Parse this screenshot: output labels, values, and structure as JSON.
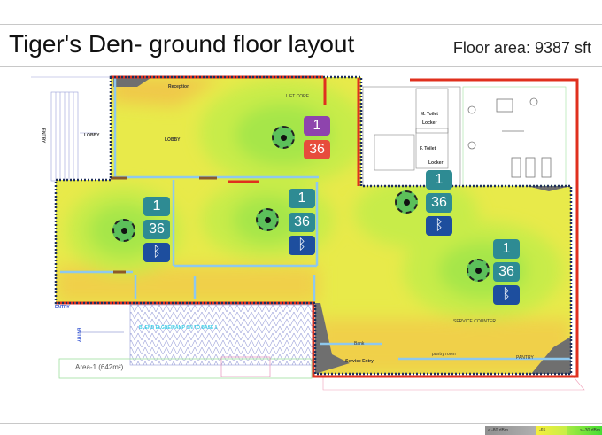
{
  "header": {
    "title": "Tiger's Den- ground floor layout",
    "floor_area": "Floor area: 9387 sft"
  },
  "rooms": {
    "lobby_outer": "LOBBY",
    "lobby_inner": "LOBBY",
    "reception": "Reception",
    "lift_core": "LIFT CORE",
    "m_toilet": "M. Toilet",
    "locker_1": "Locker",
    "f_toilet": "F. Toilet",
    "locker_2": "Locker",
    "service_counter": "SERVICE COUNTER",
    "pantry_room": "pantry room",
    "pantry": "PANTRY",
    "service_entry": "Service Entry",
    "bank": "Bank",
    "entry_top": "ENTRY",
    "entry_bottom": "ENTRY",
    "entry_corner": "ENTRY",
    "ramp": "BLEND ELGNE/RAMP ON TO BASE 1",
    "area1": "Area-1 (642m²)"
  },
  "access_points": [
    {
      "name": "ap-reception",
      "count": "1",
      "signal": "36",
      "count_color": "#8e44ad",
      "signal_color": "#e74c3c",
      "bluetooth": false
    },
    {
      "name": "ap-west-wing",
      "count": "1",
      "signal": "36",
      "count_color": "#2e8b93",
      "signal_color": "#2e8b93",
      "bluetooth": true
    },
    {
      "name": "ap-center",
      "count": "1",
      "signal": "36",
      "count_color": "#2e8b93",
      "signal_color": "#2e8b93",
      "bluetooth": true
    },
    {
      "name": "ap-east-upper",
      "count": "1",
      "signal": "36",
      "count_color": "#2e8b93",
      "signal_color": "#2e8b93",
      "bluetooth": true
    },
    {
      "name": "ap-service",
      "count": "1",
      "signal": "36",
      "count_color": "#2e8b93",
      "signal_color": "#2e8b93",
      "bluetooth": true
    }
  ],
  "legend": {
    "min": "≤ -80 dBm",
    "mid": "-65",
    "max": "≥ -30 dBm"
  },
  "colors": {
    "weak": "#808080",
    "medium": "#f0e840",
    "strong": "#44dd33",
    "wall_red": "#e0301e",
    "boundary": "#1f2f5a"
  }
}
